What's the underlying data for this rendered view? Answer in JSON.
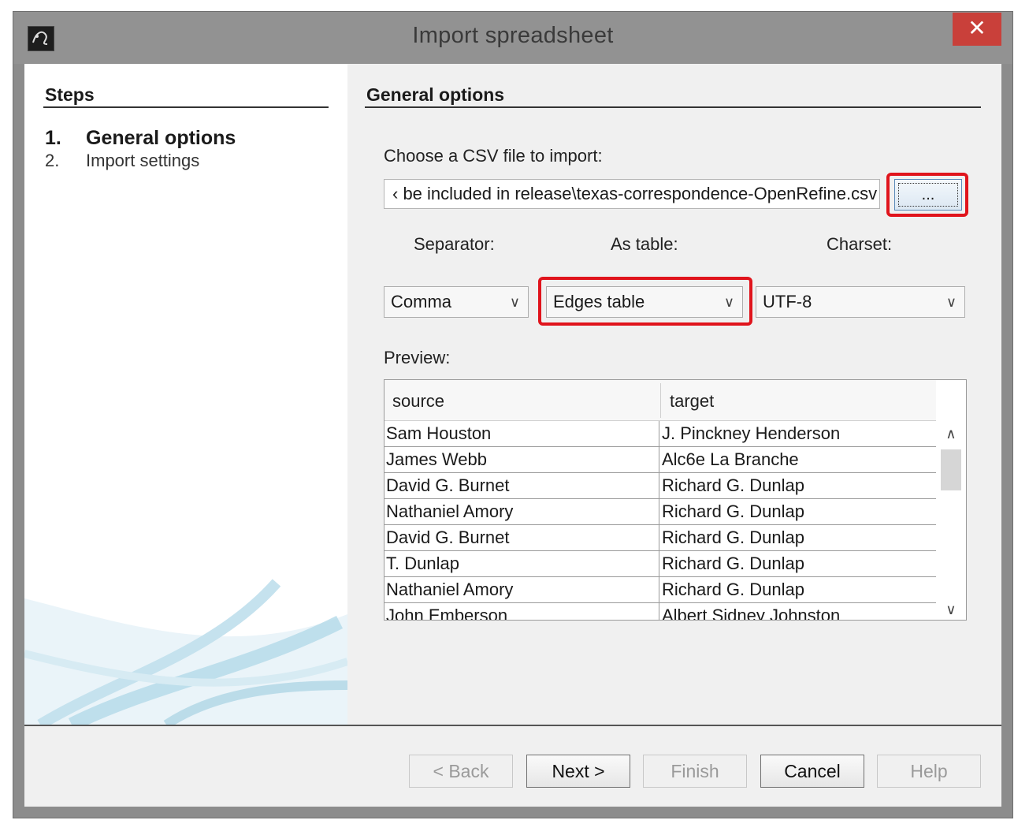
{
  "window": {
    "title": "Import spreadsheet",
    "close_glyph": "✕"
  },
  "steps": {
    "heading": "Steps",
    "items": [
      {
        "num": "1.",
        "label": "General options",
        "active": true
      },
      {
        "num": "2.",
        "label": "Import settings",
        "active": false
      }
    ]
  },
  "general": {
    "heading": "General options",
    "file_label": "Choose a CSV file to import:",
    "file_value": "‹ be included in release\\texas-correspondence-OpenRefine.csv",
    "browse_label": "...",
    "separator_label": "Separator:",
    "separator_value": "Comma",
    "as_table_label": "As table:",
    "as_table_value": "Edges table",
    "charset_label": "Charset:",
    "charset_value": "UTF-8",
    "chevron": "∨",
    "preview_label": "Preview:",
    "columns": [
      "source",
      "target"
    ],
    "rows": [
      [
        "Sam Houston",
        "J. Pinckney Henderson"
      ],
      [
        "James Webb",
        "Alc6e La Branche"
      ],
      [
        "David G. Burnet",
        "Richard G. Dunlap"
      ],
      [
        "Nathaniel Amory",
        "Richard G. Dunlap"
      ],
      [
        "David G. Burnet",
        "Richard G. Dunlap"
      ],
      [
        "T. Dunlap",
        "Richard G. Dunlap"
      ],
      [
        "Nathaniel Amory",
        "Richard G. Dunlap"
      ],
      [
        "John Emberson",
        "Albert Sidney Johnston"
      ]
    ],
    "scroll_up": "∧",
    "scroll_down": "∨"
  },
  "buttons": {
    "back": "< Back",
    "next": "Next >",
    "finish": "Finish",
    "cancel": "Cancel",
    "help": "Help"
  },
  "highlight_color": "#e0141c",
  "icons": [
    "app-logo-icon",
    "close-icon",
    "chevron-down-icon",
    "scroll-up-icon",
    "scroll-down-icon"
  ]
}
